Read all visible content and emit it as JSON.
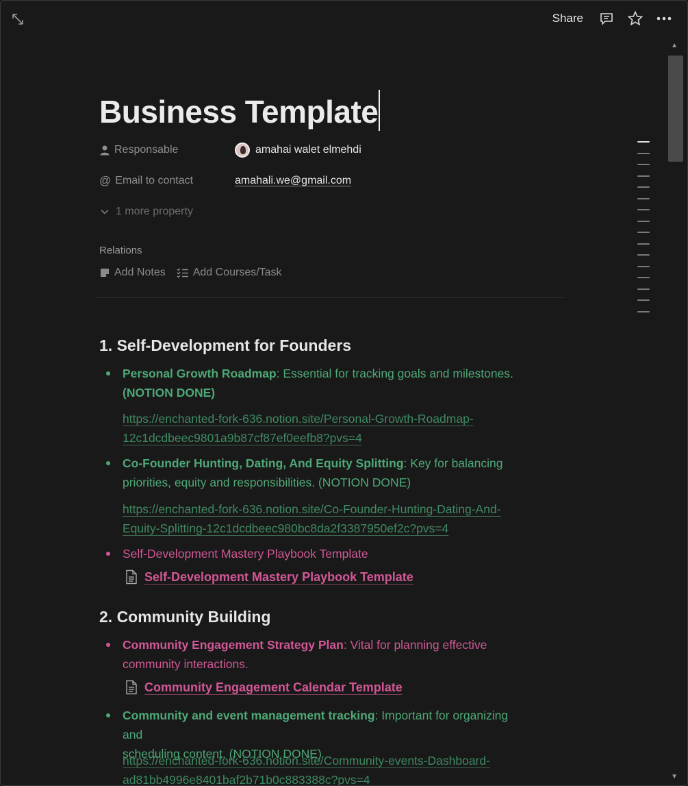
{
  "topbar": {
    "share_label": "Share"
  },
  "page": {
    "title": "Business Template"
  },
  "properties": {
    "responsable": {
      "label": "Responsable",
      "value": "amahai walet elmehdi"
    },
    "email": {
      "label": "Email to contact",
      "value": "amahali.we@gmail.com"
    },
    "more": "1 more property"
  },
  "relations": {
    "label": "Relations",
    "add_notes": "Add Notes",
    "add_courses": "Add Courses/Task"
  },
  "sections": {
    "s1": {
      "heading": "1. Self-Development for Founders",
      "b1_bold": "Personal Growth Roadmap",
      "b1_rest": ": Essential for tracking goals and milestones.",
      "b1_tag": "(NOTION DONE)",
      "b1_url_line1": "https://enchanted-fork-636.notion.site/Personal-Growth-Roadmap-",
      "b1_url_line2": "12c1dcdbeec9801a9b87cf87ef0eefb8?pvs=4",
      "b2_bold": "Co-Founder Hunting, Dating, And Equity Splitting",
      "b2_rest1": ": Key for balancing",
      "b2_rest2": "priorities, equity and responsibilities. (NOTION DONE)",
      "b2_url_line1": "https://enchanted-fork-636.notion.site/Co-Founder-Hunting-Dating-And-",
      "b2_url_line2": "Equity-Splitting-12c1dcdbeec980bc8da2f3387950ef2c?pvs=4",
      "b3_text": "Self-Development Mastery Playbook Template",
      "b3_link": "Self-Development Mastery Playbook Template"
    },
    "s2": {
      "heading": "2. Community Building",
      "b1_bold": "Community Engagement Strategy Plan",
      "b1_rest1": ": Vital for planning effective",
      "b1_rest2": "community interactions.",
      "b1_link": "Community Engagement Calendar Template",
      "b2_bold": "Community and event management tracking",
      "b2_rest1": ": Important for organizing and",
      "b2_rest2": "scheduling content. (NOTION DONE)",
      "b2_url_line1": "https://enchanted-fork-636.notion.site/Community-events-Dashboard-",
      "b2_url_line2": "ad81bb4996e8401baf2b71b0c883388c?pvs=4"
    }
  },
  "colors": {
    "background": "#191919",
    "green": "#4ea876",
    "pink": "#d15796",
    "text": "#d4d4d4"
  }
}
